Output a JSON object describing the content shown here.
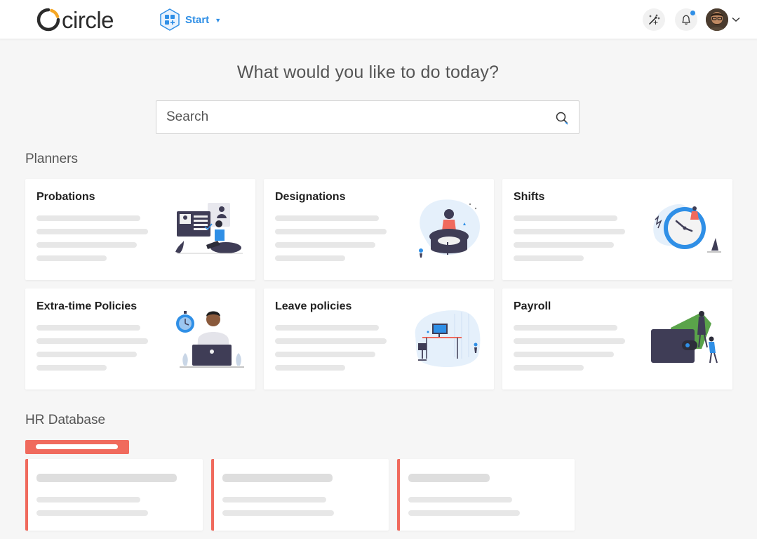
{
  "header": {
    "logo_text": "circle",
    "start_label": "Start",
    "tools_icon": "magic-wand-icon",
    "bell_icon": "bell-icon",
    "has_notification": true,
    "avatar": "user-avatar"
  },
  "main": {
    "headline": "What would you like to do today?",
    "search": {
      "placeholder": "Search",
      "value": ""
    }
  },
  "planners": {
    "title": "Planners",
    "cards": [
      {
        "title": "Probations",
        "illustration": "probations-illustration"
      },
      {
        "title": "Designations",
        "illustration": "designations-illustration"
      },
      {
        "title": "Shifts",
        "illustration": "shifts-illustration"
      },
      {
        "title": "Extra-time Policies",
        "illustration": "extra-time-illustration"
      },
      {
        "title": "Leave policies",
        "illustration": "leave-illustration"
      },
      {
        "title": "Payroll",
        "illustration": "payroll-illustration"
      }
    ]
  },
  "hr_database": {
    "title": "HR Database"
  },
  "colors": {
    "accent": "#2f8fe6",
    "hr_accent": "#f06a5d",
    "logo_orange": "#f5a623"
  }
}
